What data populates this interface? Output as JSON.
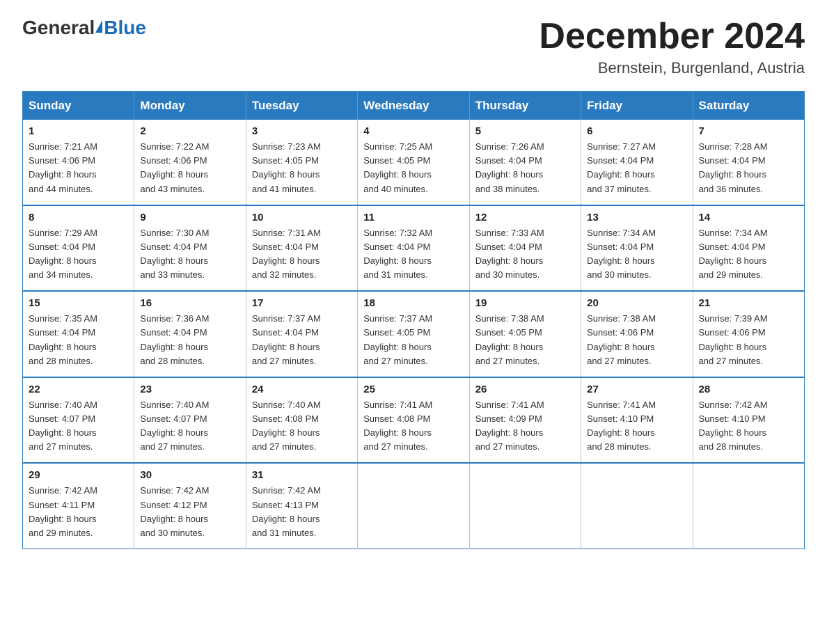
{
  "logo": {
    "general": "General",
    "blue": "Blue"
  },
  "title": "December 2024",
  "location": "Bernstein, Burgenland, Austria",
  "days_of_week": [
    "Sunday",
    "Monday",
    "Tuesday",
    "Wednesday",
    "Thursday",
    "Friday",
    "Saturday"
  ],
  "weeks": [
    [
      {
        "day": "1",
        "sunrise": "7:21 AM",
        "sunset": "4:06 PM",
        "daylight": "8 hours and 44 minutes."
      },
      {
        "day": "2",
        "sunrise": "7:22 AM",
        "sunset": "4:06 PM",
        "daylight": "8 hours and 43 minutes."
      },
      {
        "day": "3",
        "sunrise": "7:23 AM",
        "sunset": "4:05 PM",
        "daylight": "8 hours and 41 minutes."
      },
      {
        "day": "4",
        "sunrise": "7:25 AM",
        "sunset": "4:05 PM",
        "daylight": "8 hours and 40 minutes."
      },
      {
        "day": "5",
        "sunrise": "7:26 AM",
        "sunset": "4:04 PM",
        "daylight": "8 hours and 38 minutes."
      },
      {
        "day": "6",
        "sunrise": "7:27 AM",
        "sunset": "4:04 PM",
        "daylight": "8 hours and 37 minutes."
      },
      {
        "day": "7",
        "sunrise": "7:28 AM",
        "sunset": "4:04 PM",
        "daylight": "8 hours and 36 minutes."
      }
    ],
    [
      {
        "day": "8",
        "sunrise": "7:29 AM",
        "sunset": "4:04 PM",
        "daylight": "8 hours and 34 minutes."
      },
      {
        "day": "9",
        "sunrise": "7:30 AM",
        "sunset": "4:04 PM",
        "daylight": "8 hours and 33 minutes."
      },
      {
        "day": "10",
        "sunrise": "7:31 AM",
        "sunset": "4:04 PM",
        "daylight": "8 hours and 32 minutes."
      },
      {
        "day": "11",
        "sunrise": "7:32 AM",
        "sunset": "4:04 PM",
        "daylight": "8 hours and 31 minutes."
      },
      {
        "day": "12",
        "sunrise": "7:33 AM",
        "sunset": "4:04 PM",
        "daylight": "8 hours and 30 minutes."
      },
      {
        "day": "13",
        "sunrise": "7:34 AM",
        "sunset": "4:04 PM",
        "daylight": "8 hours and 30 minutes."
      },
      {
        "day": "14",
        "sunrise": "7:34 AM",
        "sunset": "4:04 PM",
        "daylight": "8 hours and 29 minutes."
      }
    ],
    [
      {
        "day": "15",
        "sunrise": "7:35 AM",
        "sunset": "4:04 PM",
        "daylight": "8 hours and 28 minutes."
      },
      {
        "day": "16",
        "sunrise": "7:36 AM",
        "sunset": "4:04 PM",
        "daylight": "8 hours and 28 minutes."
      },
      {
        "day": "17",
        "sunrise": "7:37 AM",
        "sunset": "4:04 PM",
        "daylight": "8 hours and 27 minutes."
      },
      {
        "day": "18",
        "sunrise": "7:37 AM",
        "sunset": "4:05 PM",
        "daylight": "8 hours and 27 minutes."
      },
      {
        "day": "19",
        "sunrise": "7:38 AM",
        "sunset": "4:05 PM",
        "daylight": "8 hours and 27 minutes."
      },
      {
        "day": "20",
        "sunrise": "7:38 AM",
        "sunset": "4:06 PM",
        "daylight": "8 hours and 27 minutes."
      },
      {
        "day": "21",
        "sunrise": "7:39 AM",
        "sunset": "4:06 PM",
        "daylight": "8 hours and 27 minutes."
      }
    ],
    [
      {
        "day": "22",
        "sunrise": "7:40 AM",
        "sunset": "4:07 PM",
        "daylight": "8 hours and 27 minutes."
      },
      {
        "day": "23",
        "sunrise": "7:40 AM",
        "sunset": "4:07 PM",
        "daylight": "8 hours and 27 minutes."
      },
      {
        "day": "24",
        "sunrise": "7:40 AM",
        "sunset": "4:08 PM",
        "daylight": "8 hours and 27 minutes."
      },
      {
        "day": "25",
        "sunrise": "7:41 AM",
        "sunset": "4:08 PM",
        "daylight": "8 hours and 27 minutes."
      },
      {
        "day": "26",
        "sunrise": "7:41 AM",
        "sunset": "4:09 PM",
        "daylight": "8 hours and 27 minutes."
      },
      {
        "day": "27",
        "sunrise": "7:41 AM",
        "sunset": "4:10 PM",
        "daylight": "8 hours and 28 minutes."
      },
      {
        "day": "28",
        "sunrise": "7:42 AM",
        "sunset": "4:10 PM",
        "daylight": "8 hours and 28 minutes."
      }
    ],
    [
      {
        "day": "29",
        "sunrise": "7:42 AM",
        "sunset": "4:11 PM",
        "daylight": "8 hours and 29 minutes."
      },
      {
        "day": "30",
        "sunrise": "7:42 AM",
        "sunset": "4:12 PM",
        "daylight": "8 hours and 30 minutes."
      },
      {
        "day": "31",
        "sunrise": "7:42 AM",
        "sunset": "4:13 PM",
        "daylight": "8 hours and 31 minutes."
      },
      null,
      null,
      null,
      null
    ]
  ],
  "labels": {
    "sunrise": "Sunrise:",
    "sunset": "Sunset:",
    "daylight": "Daylight:"
  }
}
